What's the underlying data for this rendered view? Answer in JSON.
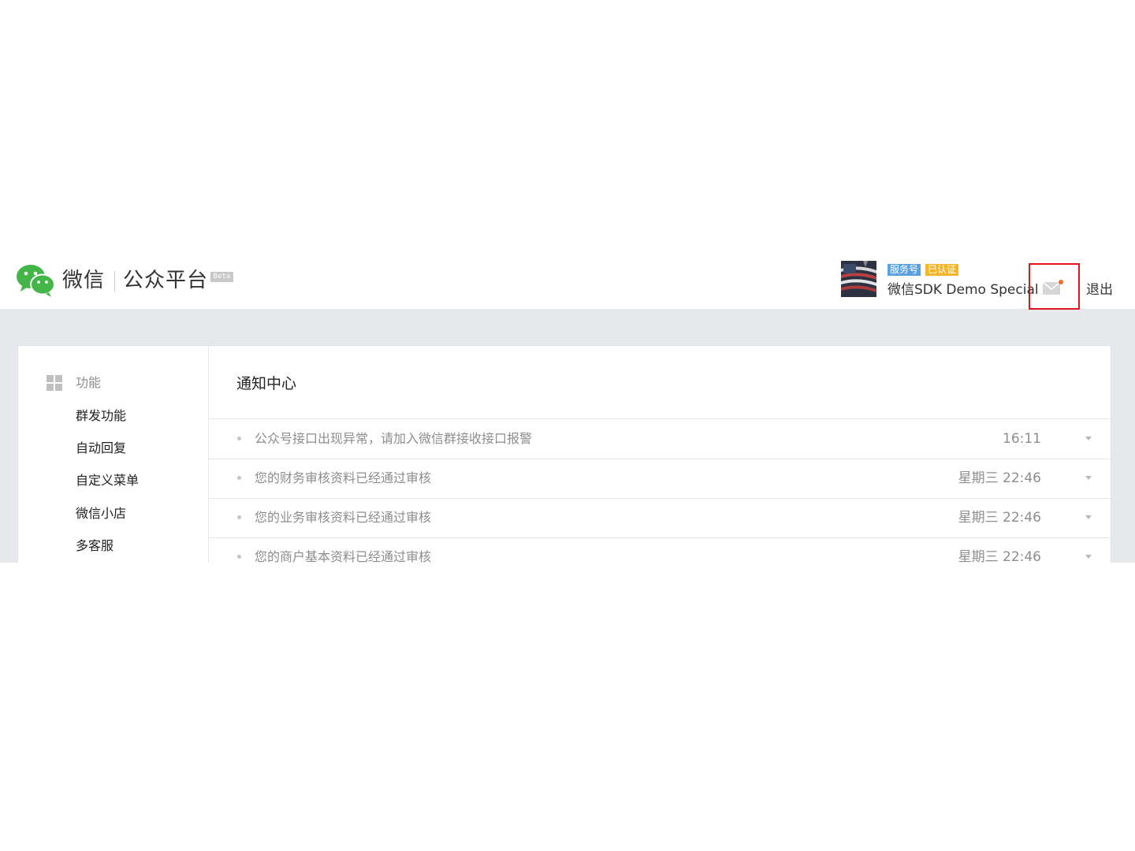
{
  "header": {
    "brand": "微信",
    "brand_sub": "公众平台",
    "beta": "Beta",
    "account_type": "服务号",
    "verified": "已认证",
    "account_name": "微信SDK Demo Special",
    "logout": "退出",
    "icons": {
      "logo": "wechat-logo-icon",
      "mail": "mail-icon"
    },
    "colors": {
      "highlight_box": "#e0141a",
      "unread_dot": "#f26c2a",
      "service_tag": "#5ba0df",
      "verified_tag": "#f4b52a",
      "brand_green": "#44b549"
    }
  },
  "sidebar": {
    "section_title": "功能",
    "section_icon": "grid-icon",
    "items": [
      {
        "label": "群发功能"
      },
      {
        "label": "自动回复"
      },
      {
        "label": "自定义菜单"
      },
      {
        "label": "微信小店"
      },
      {
        "label": "多客服"
      }
    ]
  },
  "main": {
    "title": "通知中心",
    "notices": [
      {
        "text": "公众号接口出现异常，请加入微信群接收接口报警",
        "time": "16:11"
      },
      {
        "text": "您的财务审核资料已经通过审核",
        "time": "星期三 22:46"
      },
      {
        "text": "您的业务审核资料已经通过审核",
        "time": "星期三 22:46"
      },
      {
        "text": "您的商户基本资料已经通过审核",
        "time": "星期三 22:46"
      }
    ]
  }
}
